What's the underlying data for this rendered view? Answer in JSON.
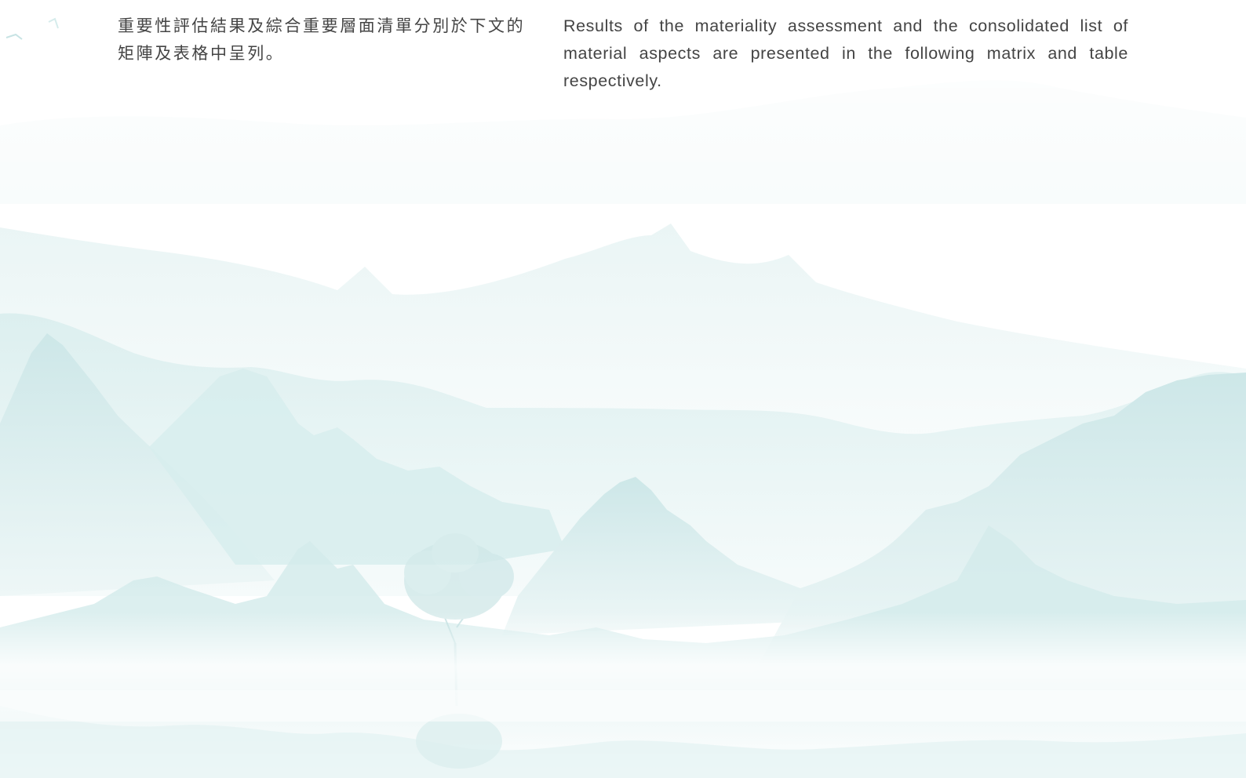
{
  "body": {
    "paragraph_zh": "重要性評估結果及綜合重要層面清單分別於下文的矩陣及表格中呈列。",
    "paragraph_en": "Results of the materiality assessment and the consolidated list of material aspects are presented in the following matrix and table respectively."
  },
  "background": {
    "illustration": "misty-mountain-landscape-with-tree",
    "colors": {
      "mountain_far": "#eef7f7",
      "mountain_mid": "#dff0f0",
      "mountain_near": "#cfe8e9",
      "mist": "#ffffff"
    }
  }
}
